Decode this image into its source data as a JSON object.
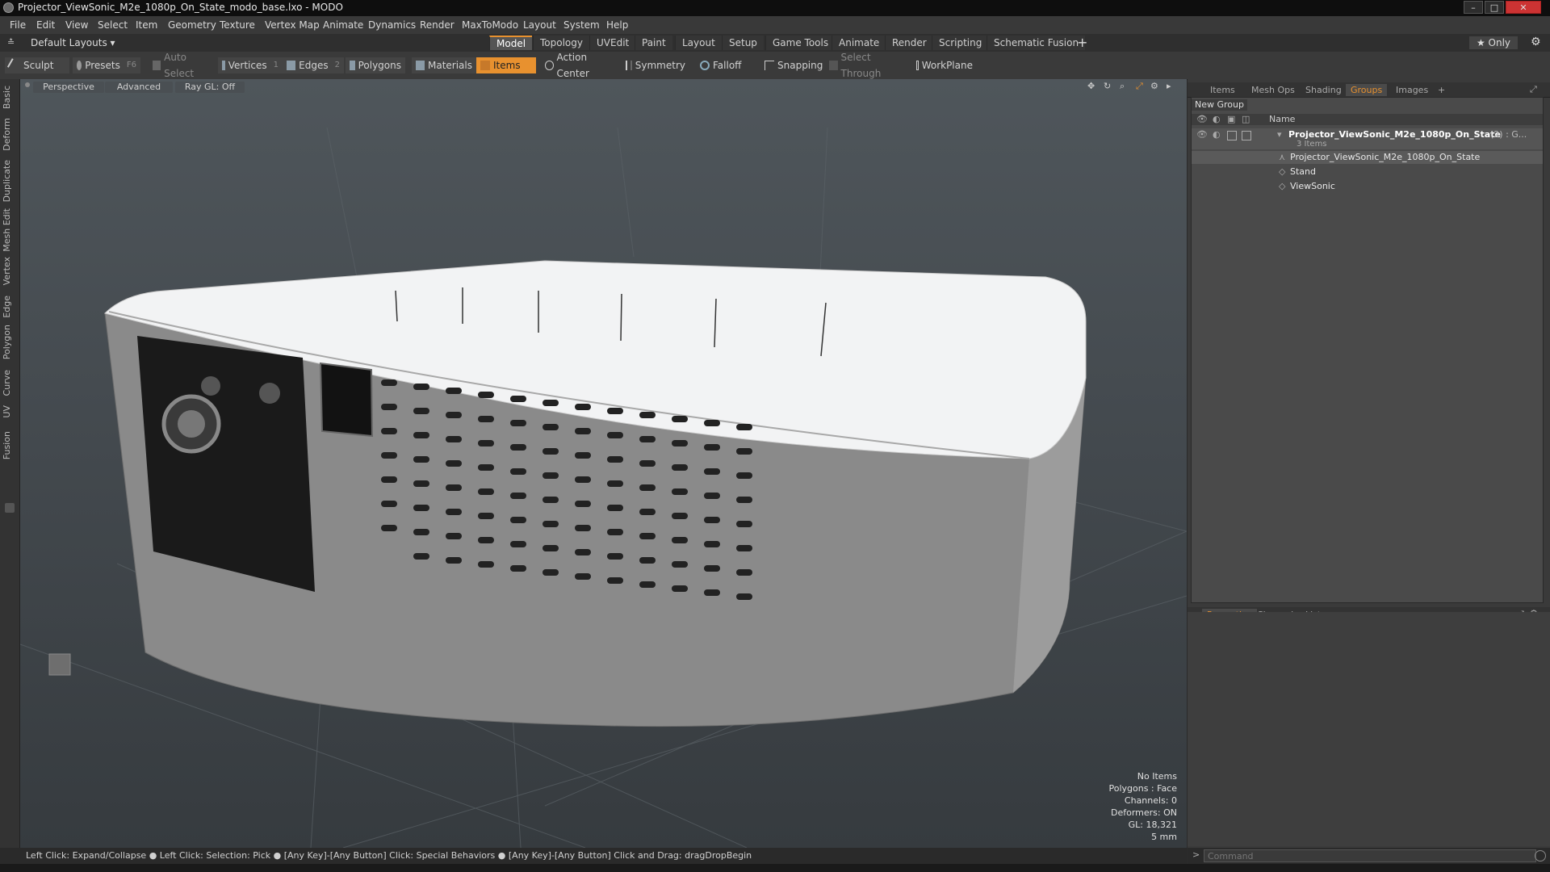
{
  "window": {
    "title": "Projector_ViewSonic_M2e_1080p_On_State_modo_base.lxo - MODO",
    "controls": [
      "–",
      "□",
      "✕"
    ]
  },
  "menu": [
    "File",
    "Edit",
    "View",
    "Select",
    "Item",
    "Geometry",
    "Texture",
    "Vertex Map",
    "Animate",
    "Dynamics",
    "Render",
    "MaxToModo",
    "Layout",
    "System",
    "Help"
  ],
  "layout_selector": "Default Layouts ▾",
  "layout_tabs": [
    "Model",
    "Topology",
    "UVEdit",
    "Paint",
    "Layout",
    "Setup",
    "Game Tools",
    "Animate",
    "Render",
    "Scripting",
    "Schematic Fusion"
  ],
  "layout_tab_active": "Model",
  "only_label": "Only",
  "toolbar": {
    "sculpt": "Sculpt",
    "presets": "Presets",
    "presets_key": "F6",
    "auto_select": "Auto Select",
    "vertices": "Vertices",
    "vertices_count": "1",
    "edges": "Edges",
    "edges_count": "2",
    "polygons": "Polygons",
    "materials": "Materials",
    "items": "Items",
    "action_center": "Action Center",
    "symmetry": "Symmetry",
    "falloff": "Falloff",
    "snapping": "Snapping",
    "select_through": "Select Through",
    "workplane": "WorkPlane"
  },
  "left_tabs": [
    "Basic",
    "Deform",
    "Duplicate",
    "Mesh Edit",
    "Vertex",
    "Edge",
    "Polygon",
    "Curve",
    "UV",
    "Fusion"
  ],
  "viewport": {
    "view_mode": "Perspective",
    "shading": "Advanced",
    "raygl": "Ray GL: Off",
    "info": [
      "No Items",
      "Polygons : Face",
      "Channels: 0",
      "Deformers: ON",
      "GL: 18,321",
      "5 mm"
    ]
  },
  "top_panel": {
    "tabs": [
      "Items",
      "Mesh Ops",
      "Shading",
      "Groups",
      "Images"
    ],
    "active_tab": "Groups",
    "new_group": "New Group",
    "name_header": "Name",
    "group_name": "Projector_ViewSonic_M2e_1080p_On_State",
    "group_suffix": "(2) : G...",
    "group_count": "3 Items",
    "children": [
      "Projector_ViewSonic_M2e_1080p_On_State",
      "Stand",
      "ViewSonic"
    ]
  },
  "bottom_panel": {
    "tabs": [
      "Properties",
      "Channels",
      "Lists"
    ],
    "active_tab": "Properties"
  },
  "status": "Left Click: Expand/Collapse ● Left Click: Selection: Pick ● [Any Key]-[Any Button] Click: Special Behaviors ● [Any Key]-[Any Button] Click and Drag: dragDropBegin",
  "command_placeholder": "Command",
  "colors": {
    "accent": "#e8912f",
    "viewport_top": "#4f565b",
    "viewport_bottom": "#363b3f"
  }
}
